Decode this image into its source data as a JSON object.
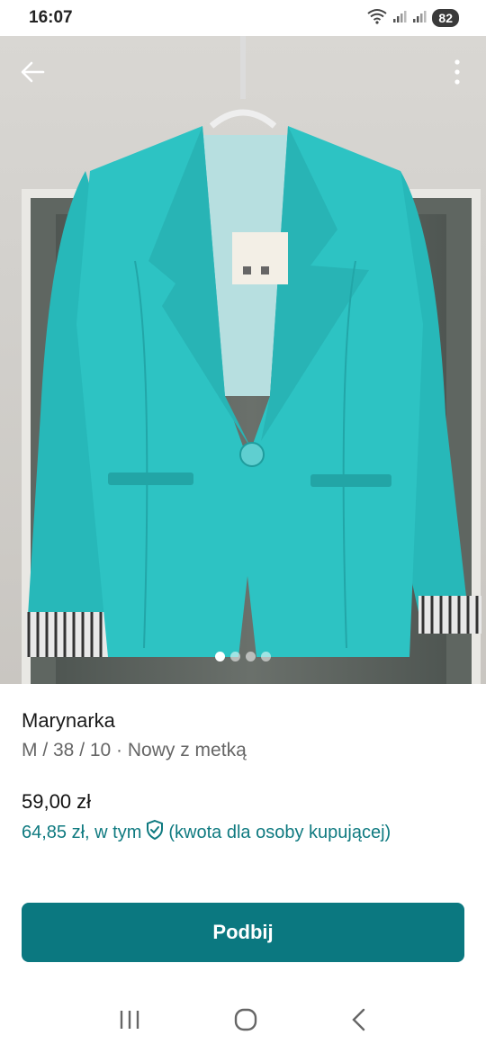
{
  "status_bar": {
    "time": "16:07",
    "battery": "82",
    "icons": [
      "wifi-icon",
      "signal-icon",
      "signal-icon"
    ]
  },
  "photo": {
    "back_icon": "arrow-left-icon",
    "more_icon": "more-vertical-icon",
    "pages_total": 4,
    "current_page": 1
  },
  "item": {
    "title": "Marynarka",
    "details": "M / 38 / 10 · Nowy z metką",
    "price": "59,00 zł",
    "total_price": "64,85 zł, w tym",
    "protection_icon": "shield-check-icon",
    "total_note": "(kwota dla osoby kupującej)"
  },
  "actions": {
    "primary_label": "Podbij"
  },
  "system_nav": {
    "icons": [
      "recents-icon",
      "home-icon",
      "back-icon"
    ]
  },
  "colors": {
    "accent": "#0b7880",
    "accent_text": "#0f7a80",
    "jacket": "#2bc4c4"
  }
}
